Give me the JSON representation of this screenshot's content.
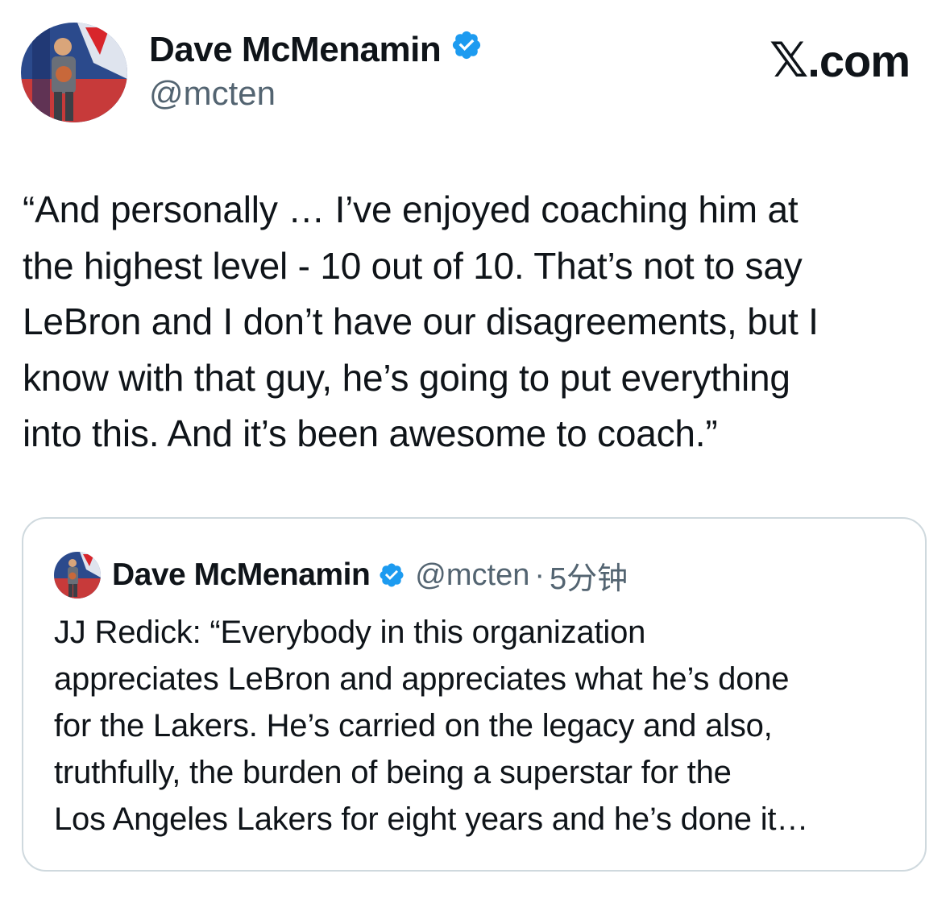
{
  "author": {
    "name": "Dave McMenamin",
    "handle": "@mcten",
    "verified_color": "#1d9bf0"
  },
  "brand": {
    "label": ".com",
    "icon": "x-logo-icon"
  },
  "tweet": {
    "lines": [
      "“And personally … I’ve enjoyed coaching him  at",
      "the highest level - 10 out of 10. That’s not to say",
      "LeBron and I don’t have our disagreements, but I",
      "know with that guy, he’s going to put everything",
      "into this. And it’s been awesome to coach.”"
    ]
  },
  "quoted": {
    "name": "Dave McMenamin",
    "handle": "@mcten",
    "separator": "·",
    "time": "5分钟",
    "lines": [
      "JJ Redick: “Everybody in this organization",
      "appreciates LeBron and appreciates what he’s done",
      "for the Lakers. He’s carried on the legacy and also,",
      "truthfully, the burden of being a superstar for the",
      "Los Angeles Lakers for eight years and he’s done it…"
    ]
  },
  "colors": {
    "text": "#0f1419",
    "secondary": "#536471",
    "border": "#cfd9de",
    "verified": "#1d9bf0"
  }
}
